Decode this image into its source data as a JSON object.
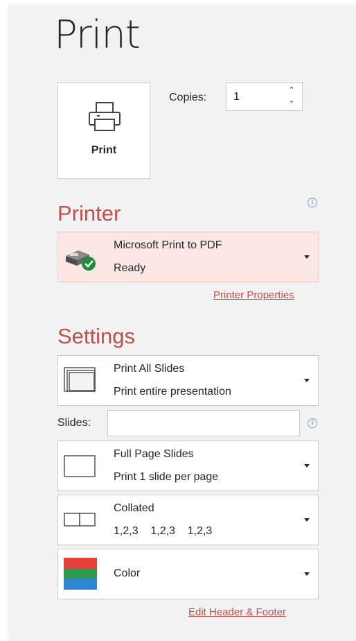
{
  "title": "Print",
  "print_button": {
    "label": "Print"
  },
  "copies": {
    "label": "Copies:",
    "value": "1"
  },
  "printer": {
    "heading": "Printer",
    "name": "Microsoft Print to PDF",
    "status": "Ready",
    "properties_link": "Printer Properties"
  },
  "settings": {
    "heading": "Settings",
    "range": {
      "title": "Print All Slides",
      "subtitle": "Print entire presentation"
    },
    "slides": {
      "label": "Slides:",
      "value": ""
    },
    "layout": {
      "title": "Full Page Slides",
      "subtitle": "Print 1 slide per page"
    },
    "collation": {
      "title": "Collated",
      "subtitle": "1,2,3    1,2,3    1,2,3"
    },
    "color": {
      "title": "Color"
    },
    "edit_link": "Edit Header & Footer"
  },
  "colors": {
    "accent": "#c0504d",
    "printer_bg": "#fde7e4",
    "ready_green": "#1e8c3a"
  }
}
